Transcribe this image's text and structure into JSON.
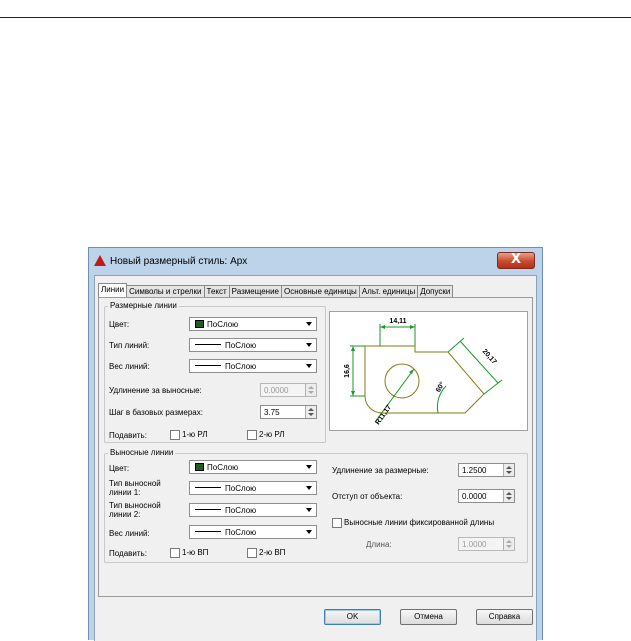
{
  "dialog": {
    "title": "Новый размерный стиль: Арх",
    "close_symbol": "X"
  },
  "tabs": [
    {
      "label": "Линии",
      "active": true
    },
    {
      "label": "Символы и стрелки",
      "active": false
    },
    {
      "label": "Текст",
      "active": false
    },
    {
      "label": "Размещение",
      "active": false
    },
    {
      "label": "Основные единицы",
      "active": false
    },
    {
      "label": "Альт. единицы",
      "active": false
    },
    {
      "label": "Допуски",
      "active": false
    }
  ],
  "dimension_lines": {
    "group_title": "Размерные линии",
    "color_label": "Цвет:",
    "color_value": "ПоСлою",
    "linetype_label": "Тип линий:",
    "linetype_value": "ПоСлою",
    "lineweight_label": "Вес линий:",
    "lineweight_value": "ПоСлою",
    "extend_label": "Удлинение за выносные:",
    "extend_value": "0.0000",
    "baseline_label": "Шаг в базовых размерах:",
    "baseline_value": "3.75",
    "suppress_label": "Подавить:",
    "suppress_1": "1-ю РЛ",
    "suppress_2": "2-ю РЛ"
  },
  "extension_lines": {
    "group_title": "Выносные линии",
    "color_label": "Цвет:",
    "color_value": "ПоСлою",
    "linetype1_label": "Тип выносной линии 1:",
    "linetype1_value": "ПоСлою",
    "linetype2_label": "Тип выносной линии 2:",
    "linetype2_value": "ПоСлою",
    "lineweight_label": "Вес линий:",
    "lineweight_value": "ПоСлою",
    "suppress_label": "Подавить:",
    "suppress_1": "1-ю ВП",
    "suppress_2": "2-ю ВП",
    "extend_beyond_label": "Удлинение за размерные:",
    "extend_beyond_value": "1.2500",
    "offset_label": "Отступ от объекта:",
    "offset_value": "0.0000",
    "fixed_length_label": "Выносные линии фиксированной длины",
    "length_label": "Длина:",
    "length_value": "1.0000"
  },
  "preview": {
    "dim_top": "14,11",
    "dim_left": "16,6",
    "dim_right": "20,17",
    "dim_angle": "60°",
    "dim_radius": "R11,17"
  },
  "buttons": {
    "ok": "OK",
    "cancel": "Отмена",
    "help": "Справка"
  },
  "colors": {
    "dim_line": "#1a9a2a",
    "object_line": "#8a7a12",
    "swatch": "#1f5e1f"
  }
}
